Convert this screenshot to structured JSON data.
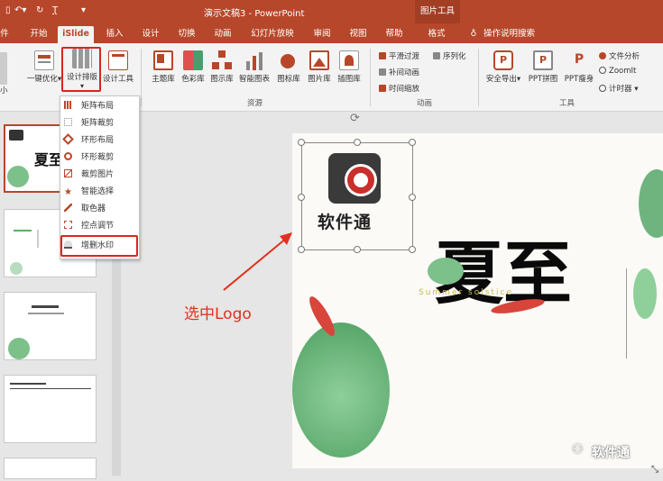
{
  "titlebar": {
    "doc_title": "演示文稿3  -  PowerPoint",
    "context_tab": "图片工具"
  },
  "tabs": [
    "开始",
    "iSlide",
    "插入",
    "设计",
    "切换",
    "动画",
    "幻灯片放映",
    "审阅",
    "视图",
    "帮助",
    "格式"
  ],
  "tell_me": "操作说明搜索",
  "ribbon": {
    "left_buttons": [
      "一键优化",
      "设计排版",
      "设计工具"
    ],
    "resource_buttons": [
      "主题库",
      "色彩库",
      "图示库",
      "智能图表",
      "图标库",
      "图片库",
      "插图库"
    ],
    "resource_group": "资源",
    "animation_items": [
      "平滑过渡",
      "补间动画",
      "时间缩放",
      "序列化"
    ],
    "animation_group": "动画",
    "tool_buttons": [
      "安全导出",
      "PPT拼图",
      "PPT瘦身"
    ],
    "tool_items": [
      "文件分析",
      "ZoomIt",
      "计时器"
    ],
    "tool_group": "工具"
  },
  "dropdown": {
    "items": [
      "矩阵布局",
      "矩阵裁剪",
      "环形布局",
      "环形裁剪",
      "裁剪图片",
      "智能选择",
      "取色器",
      "控点调节",
      "增删水印"
    ]
  },
  "slide": {
    "logo_text": "软件通",
    "title": "夏至",
    "subtitle": "Summer solstice"
  },
  "annotation": "选中Logo",
  "watermark": "软件通",
  "colors": {
    "accent": "#b7472a",
    "highlight": "#d9261c"
  }
}
